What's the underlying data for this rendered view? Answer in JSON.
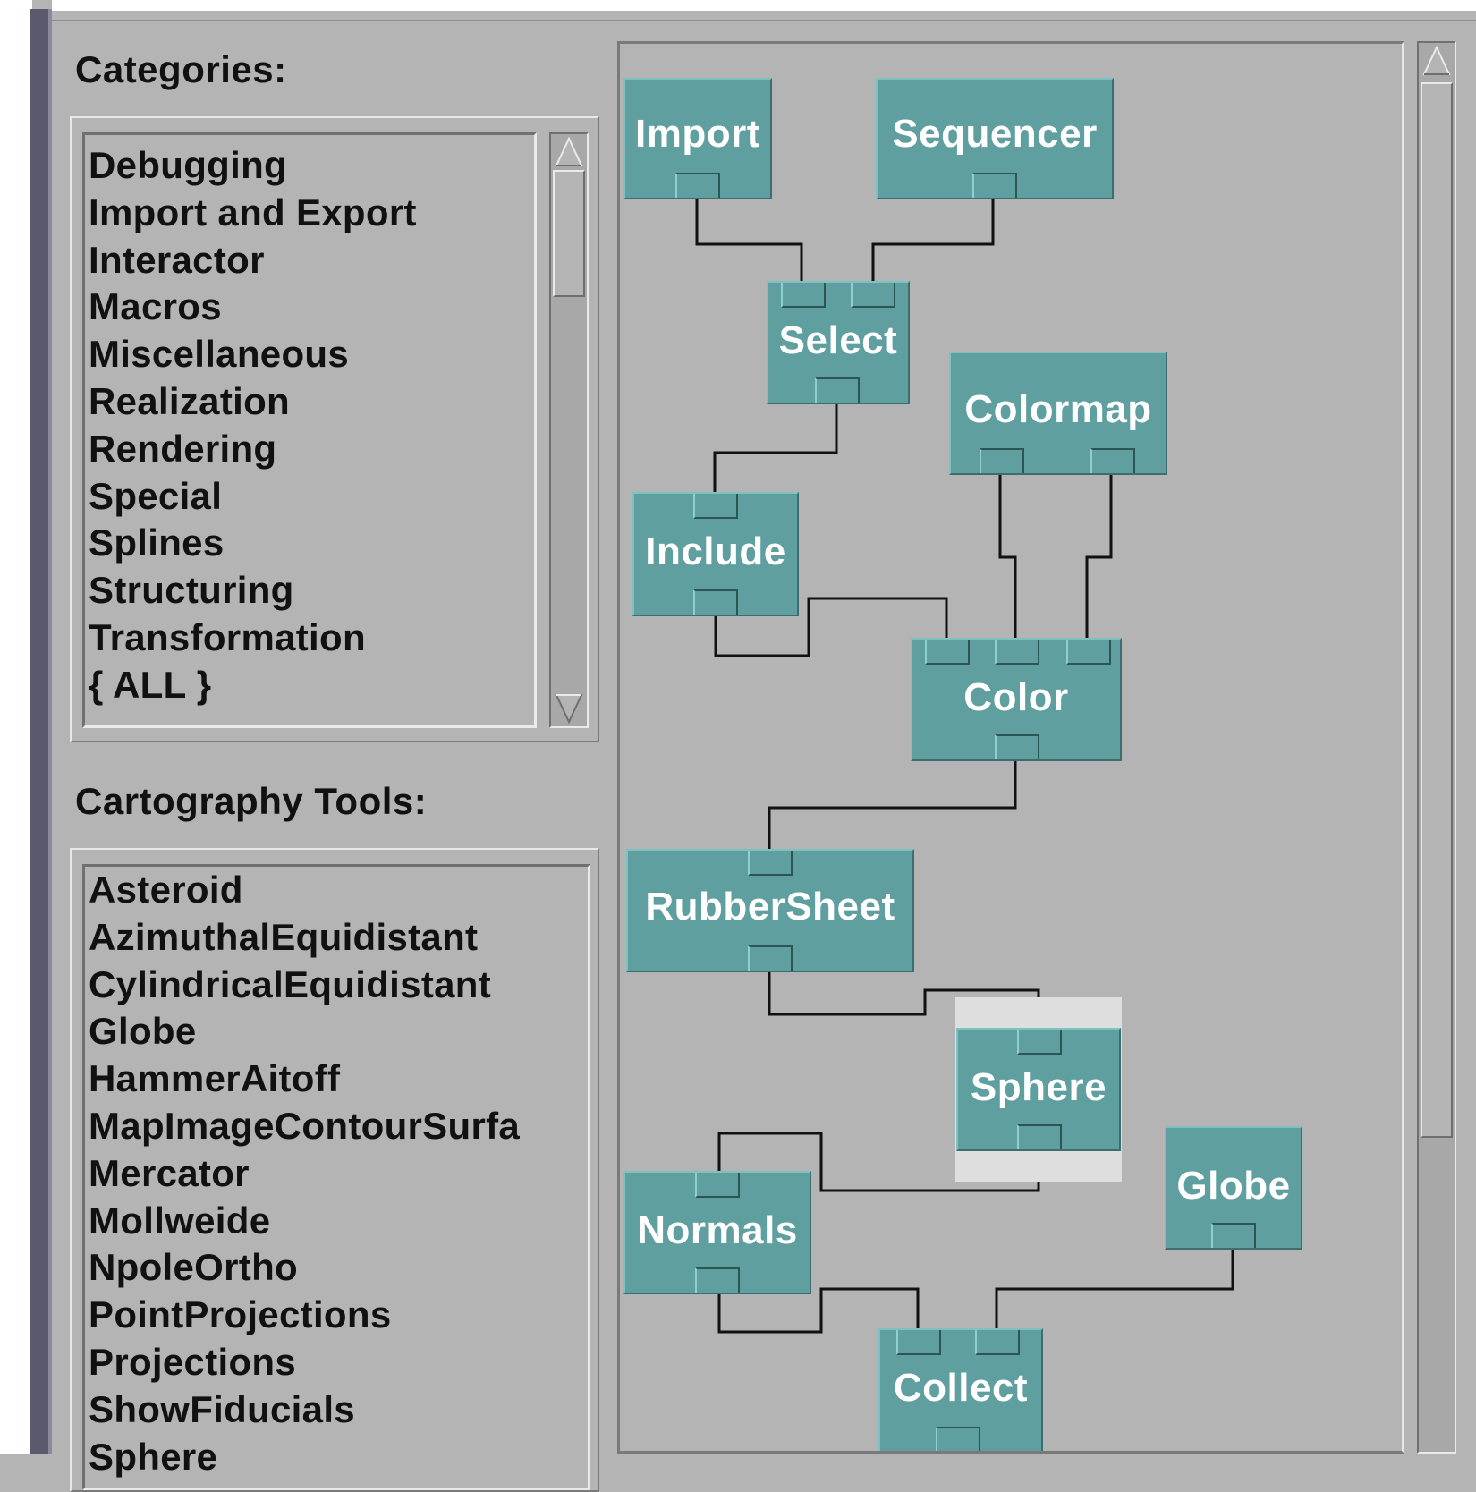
{
  "categories": {
    "label": "Categories:",
    "items": [
      "Debugging",
      "Import and Export",
      "Interactor",
      "Macros",
      "Miscellaneous",
      "Realization",
      "Rendering",
      "Special",
      "Splines",
      "Structuring",
      "Transformation",
      "{ ALL }"
    ]
  },
  "tools": {
    "label": "Cartography Tools:",
    "items": [
      "Asteroid",
      "AzimuthalEquidistant",
      "CylindricalEquidistant",
      "Globe",
      "HammerAitoff",
      "MapImageContourSurfa",
      "Mercator",
      "Mollweide",
      "NpoleOrtho",
      "PointProjections",
      "Projections",
      "ShowFiducials",
      "Sphere"
    ]
  },
  "network": {
    "nodes": {
      "import": "Import",
      "sequencer": "Sequencer",
      "select": "Select",
      "colormap": "Colormap",
      "include": "Include",
      "color": "Color",
      "rubbersheet": "RubberSheet",
      "sphere": "Sphere",
      "globe": "Globe",
      "normals": "Normals",
      "collect": "Collect"
    },
    "node_color": "#5f9fa0",
    "wire_color": "#111111"
  }
}
